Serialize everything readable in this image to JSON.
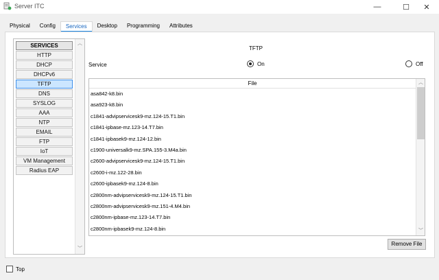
{
  "window": {
    "title": "Server ITC",
    "minimize": "—",
    "maximize": "☐",
    "close": "✕"
  },
  "tabs": [
    {
      "label": "Physical"
    },
    {
      "label": "Config"
    },
    {
      "label": "Services"
    },
    {
      "label": "Desktop"
    },
    {
      "label": "Programming"
    },
    {
      "label": "Attributes"
    }
  ],
  "active_tab": "Services",
  "services": {
    "header": "SERVICES",
    "items": [
      "HTTP",
      "DHCP",
      "DHCPv6",
      "TFTP",
      "DNS",
      "SYSLOG",
      "AAA",
      "NTP",
      "EMAIL",
      "FTP",
      "IoT",
      "VM Management",
      "Radius EAP"
    ],
    "selected": "TFTP"
  },
  "tftp": {
    "title": "TFTP",
    "service_label": "Service",
    "on_label": "On",
    "off_label": "Off",
    "service_state": "On",
    "file_header": "File",
    "files": [
      "asa842-k8.bin",
      "asa923-k8.bin",
      "c1841-advipservicesk9-mz.124-15.T1.bin",
      "c1841-ipbase-mz.123-14.T7.bin",
      "c1841-ipbasek9-mz.124-12.bin",
      "c1900-universalk9-mz.SPA.155-3.M4a.bin",
      "c2600-advipservicesk9-mz.124-15.T1.bin",
      "c2600-i-mz.122-28.bin",
      "c2600-ipbasek9-mz.124-8.bin",
      "c2800nm-advipservicesk9-mz.124-15.T1.bin",
      "c2800nm-advipservicesk9-mz.151-4.M4.bin",
      "c2800nm-ipbase-mz.123-14.T7.bin",
      "c2800nm-ipbasek9-mz.124-8.bin"
    ],
    "remove_button": "Remove File"
  },
  "footer": {
    "top_label": "Top"
  }
}
